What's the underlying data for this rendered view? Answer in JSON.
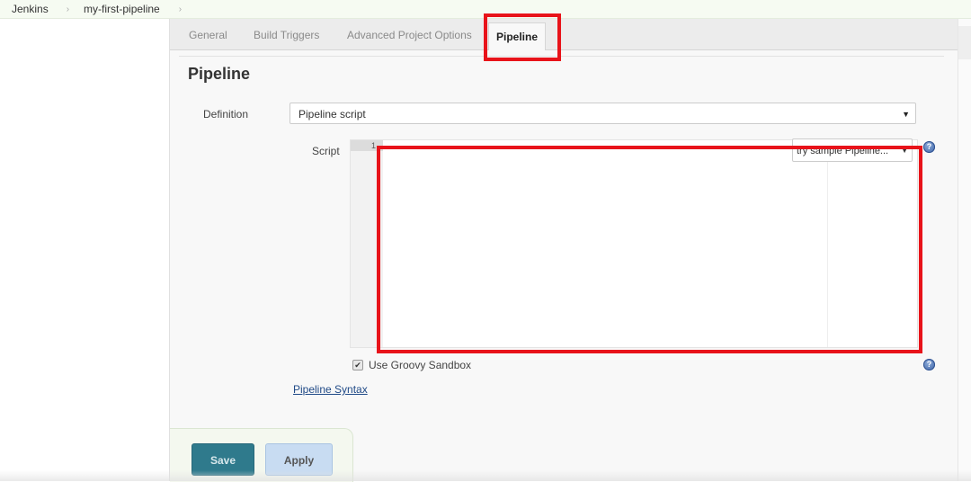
{
  "breadcrumb": {
    "items": [
      "Jenkins",
      "my-first-pipeline"
    ],
    "separator": "›"
  },
  "tabs": [
    {
      "label": "General",
      "active": false
    },
    {
      "label": "Build Triggers",
      "active": false
    },
    {
      "label": "Advanced Project Options",
      "active": false
    },
    {
      "label": "Pipeline",
      "active": true
    }
  ],
  "section": {
    "title": "Pipeline",
    "definition_label": "Definition",
    "definition_value": "Pipeline script",
    "script_label": "Script",
    "line_number": "1",
    "script_content": "",
    "sample_select_value": "try sample Pipeline...",
    "sandbox_label": "Use Groovy Sandbox",
    "sandbox_checked": true,
    "syntax_link": "Pipeline Syntax"
  },
  "icons": {
    "dropdown_arrow": "▼",
    "help": "?",
    "check": "✔"
  },
  "buttons": {
    "save": "Save",
    "apply": "Apply"
  },
  "colors": {
    "highlight": "#e8131a",
    "save_bg": "#2f7a8c",
    "apply_bg": "#c8dcf2",
    "link": "#204a87"
  }
}
